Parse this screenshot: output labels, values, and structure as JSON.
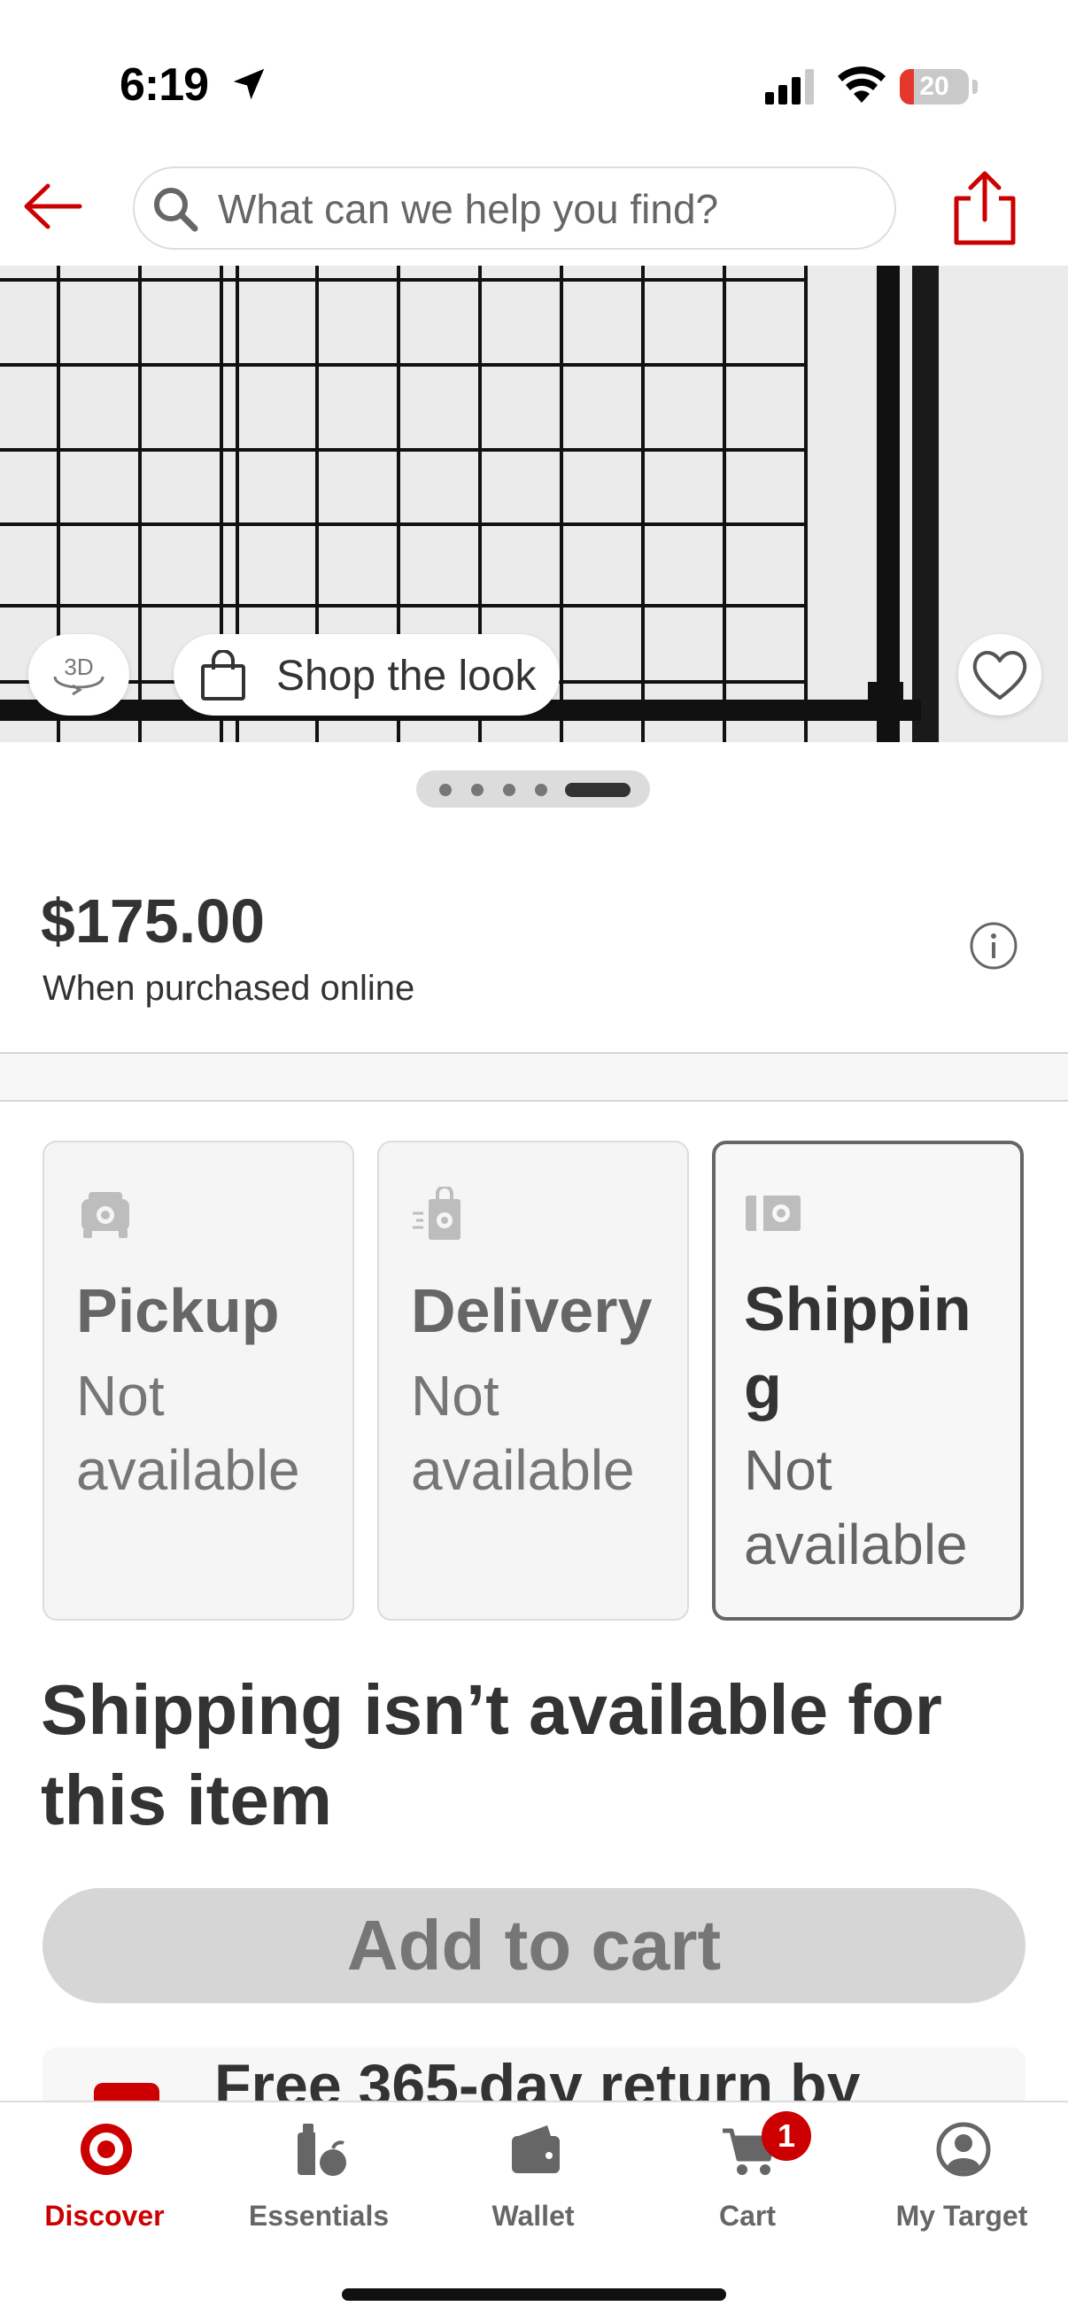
{
  "status_bar": {
    "time": "6:19",
    "battery_level": "20",
    "battery_percent": 20,
    "battery_color": "#e6372d"
  },
  "header": {
    "back_icon": "arrow-left-icon",
    "search_placeholder": "What can we help you find?",
    "share_icon": "share-icon",
    "accent_color": "#cc0000"
  },
  "hero": {
    "view_3d_label": "3D",
    "shop_the_look_label": "Shop the look",
    "favorite_icon": "heart-icon",
    "carousel": {
      "total": 5,
      "active_index": 4
    }
  },
  "price": {
    "amount": "$175.00",
    "note": "When purchased online",
    "info_icon": "info-icon"
  },
  "fulfillment": {
    "options": [
      {
        "title": "Pickup",
        "status": "Not available",
        "icon": "car-icon",
        "selected": false
      },
      {
        "title": "Delivery",
        "status": "Not available",
        "icon": "bag-delivery-icon",
        "selected": false
      },
      {
        "title": "Shipping",
        "status": "Not available",
        "icon": "shipping-box-icon",
        "selected": true
      }
    ],
    "message": "Shipping isn’t available for this item"
  },
  "add_to_cart": {
    "label": "Add to cart",
    "enabled": false
  },
  "returns_banner": {
    "text": "Free 365-day return by"
  },
  "tabbar": {
    "tabs": [
      {
        "label": "Discover",
        "icon": "target-bullseye-icon",
        "active": true
      },
      {
        "label": "Essentials",
        "icon": "essentials-icon",
        "active": false
      },
      {
        "label": "Wallet",
        "icon": "wallet-icon",
        "active": false
      },
      {
        "label": "Cart",
        "icon": "cart-icon",
        "active": false
      },
      {
        "label": "My Target",
        "icon": "user-circle-icon",
        "active": false
      }
    ],
    "cart_count": "1"
  }
}
